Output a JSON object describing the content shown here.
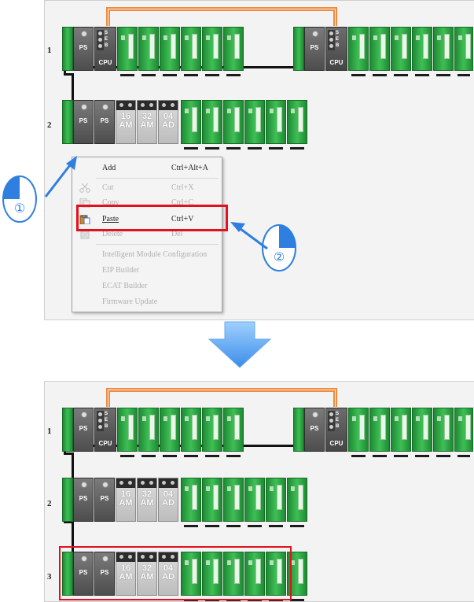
{
  "top": {
    "row_labels": [
      "1",
      "2"
    ],
    "rack1": {
      "ps": "PS",
      "cpu": "CPU",
      "cpu_switch_letters": [
        "S",
        "E",
        "B"
      ]
    },
    "rack2": {
      "ps1": "PS",
      "ps2": "PS",
      "io": [
        {
          "top": "16",
          "bottom": "AM"
        },
        {
          "top": "32",
          "bottom": "AM"
        },
        {
          "top": "04",
          "bottom": "AD"
        }
      ]
    },
    "context_menu": {
      "items": [
        {
          "label": "Add",
          "shortcut": "Ctrl+Alt+A",
          "enabled": true,
          "icon": "none"
        },
        {
          "label": "Cut",
          "shortcut": "Ctrl+X",
          "enabled": false,
          "icon": "scissors-icon"
        },
        {
          "label": "Copy",
          "shortcut": "Ctrl+C",
          "enabled": false,
          "icon": "copy-icon"
        },
        {
          "label": "Paste",
          "shortcut": "Ctrl+V",
          "enabled": true,
          "icon": "paste-icon"
        },
        {
          "label": "Delete",
          "shortcut": "Del",
          "enabled": false,
          "icon": "delete-icon"
        },
        {
          "label": "Intelligent Module Configuration",
          "shortcut": "",
          "enabled": false,
          "icon": "none"
        },
        {
          "label": "EIP Builder",
          "shortcut": "",
          "enabled": false,
          "icon": "none"
        },
        {
          "label": "ECAT Builder",
          "shortcut": "",
          "enabled": false,
          "icon": "none"
        },
        {
          "label": "Firmware Update",
          "shortcut": "",
          "enabled": false,
          "icon": "none"
        }
      ]
    },
    "callouts": [
      "①",
      "②"
    ]
  },
  "bottom": {
    "row_labels": [
      "1",
      "2",
      "3"
    ]
  },
  "colors": {
    "accent_red": "#e2111d",
    "arrow_blue": "#2f7fe0",
    "ethernet_orange": "#f08a3c",
    "module_green": "#2fa84a"
  }
}
